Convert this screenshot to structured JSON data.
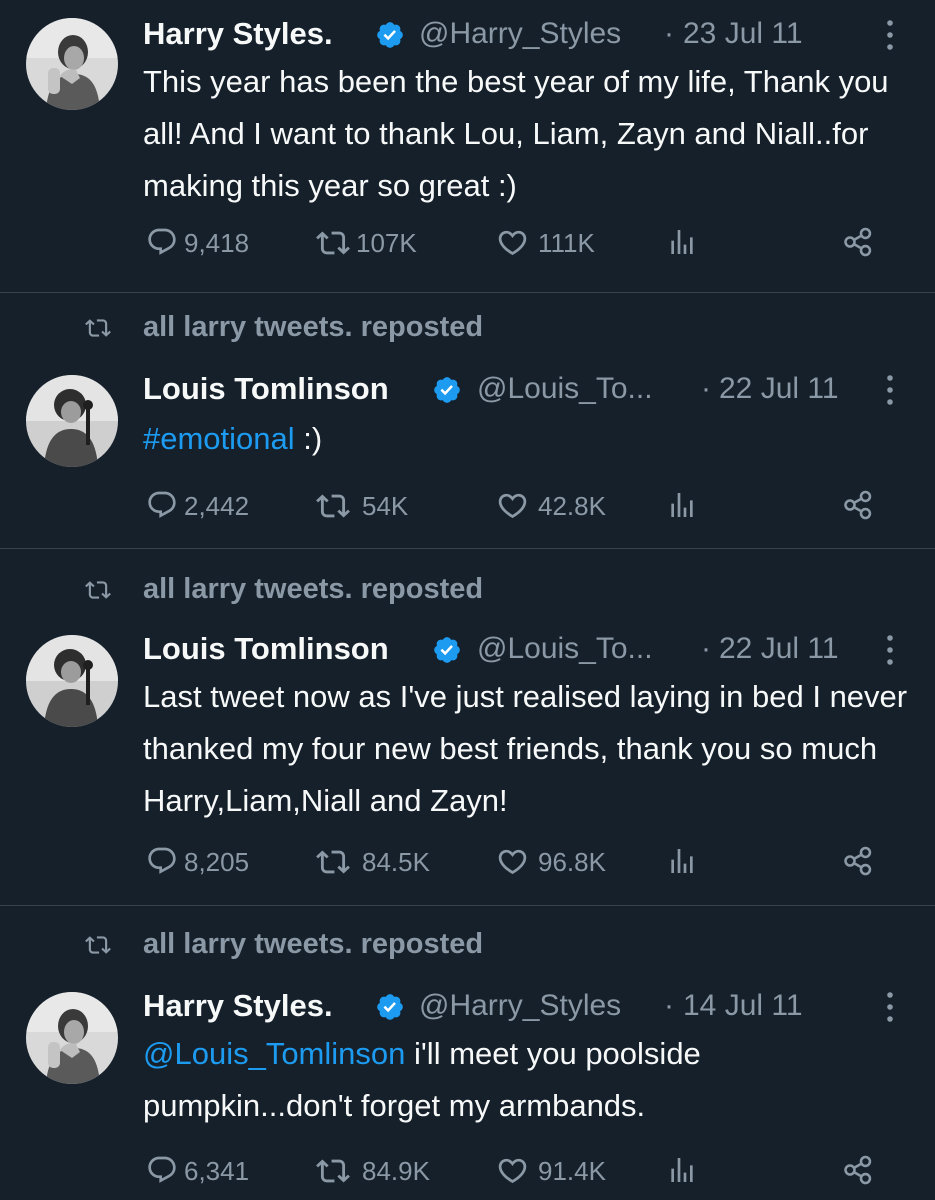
{
  "colors": {
    "background": "#15202b",
    "text_primary": "#f7f9f9",
    "text_secondary": "#8b98a5",
    "link": "#1d9bf0",
    "verified": "#1d9bf0",
    "divider": "#38444d"
  },
  "tweets": [
    {
      "repost_label": "",
      "author": {
        "display_name": "Harry Styles.",
        "handle": "@Harry_Styles",
        "verified_icon": "verified-badge-icon",
        "avatar": "avatar-harry"
      },
      "separator": "·",
      "date": "23 Jul 11",
      "text": "This year has been the best year of my life, Thank you all! And I want to thank Lou, Liam, Zayn and Niall..for making this year so great :)",
      "stats": {
        "replies": "9,418",
        "reposts": "107K",
        "likes": "111K"
      }
    },
    {
      "repost_label": "all larry tweets. reposted",
      "author": {
        "display_name": "Louis Tomlinson",
        "handle": "@Louis_To...",
        "verified_icon": "verified-badge-icon",
        "avatar": "avatar-louis"
      },
      "separator": "·",
      "date": "22 Jul 11",
      "text_link": "#emotional",
      "text": " :)",
      "stats": {
        "replies": "2,442",
        "reposts": "54K",
        "likes": "42.8K"
      }
    },
    {
      "repost_label": "all larry tweets. reposted",
      "author": {
        "display_name": "Louis Tomlinson",
        "handle": "@Louis_To...",
        "verified_icon": "verified-badge-icon",
        "avatar": "avatar-louis"
      },
      "separator": "·",
      "date": "22 Jul 11",
      "text": "Last tweet now as I've just realised laying in bed I never thanked my four new best friends, thank you so much Harry,Liam,Niall and Zayn!",
      "stats": {
        "replies": "8,205",
        "reposts": "84.5K",
        "likes": "96.8K"
      }
    },
    {
      "repost_label": "all larry tweets. reposted",
      "author": {
        "display_name": "Harry Styles.",
        "handle": "@Harry_Styles",
        "verified_icon": "verified-badge-icon",
        "avatar": "avatar-harry"
      },
      "separator": "·",
      "date": "14 Jul 11",
      "text_link": "@Louis_Tomlinson",
      "text": " i'll meet you poolside pumpkin...don't forget my armbands.",
      "stats": {
        "replies": "6,341",
        "reposts": "84.9K",
        "likes": "91.4K"
      }
    }
  ]
}
